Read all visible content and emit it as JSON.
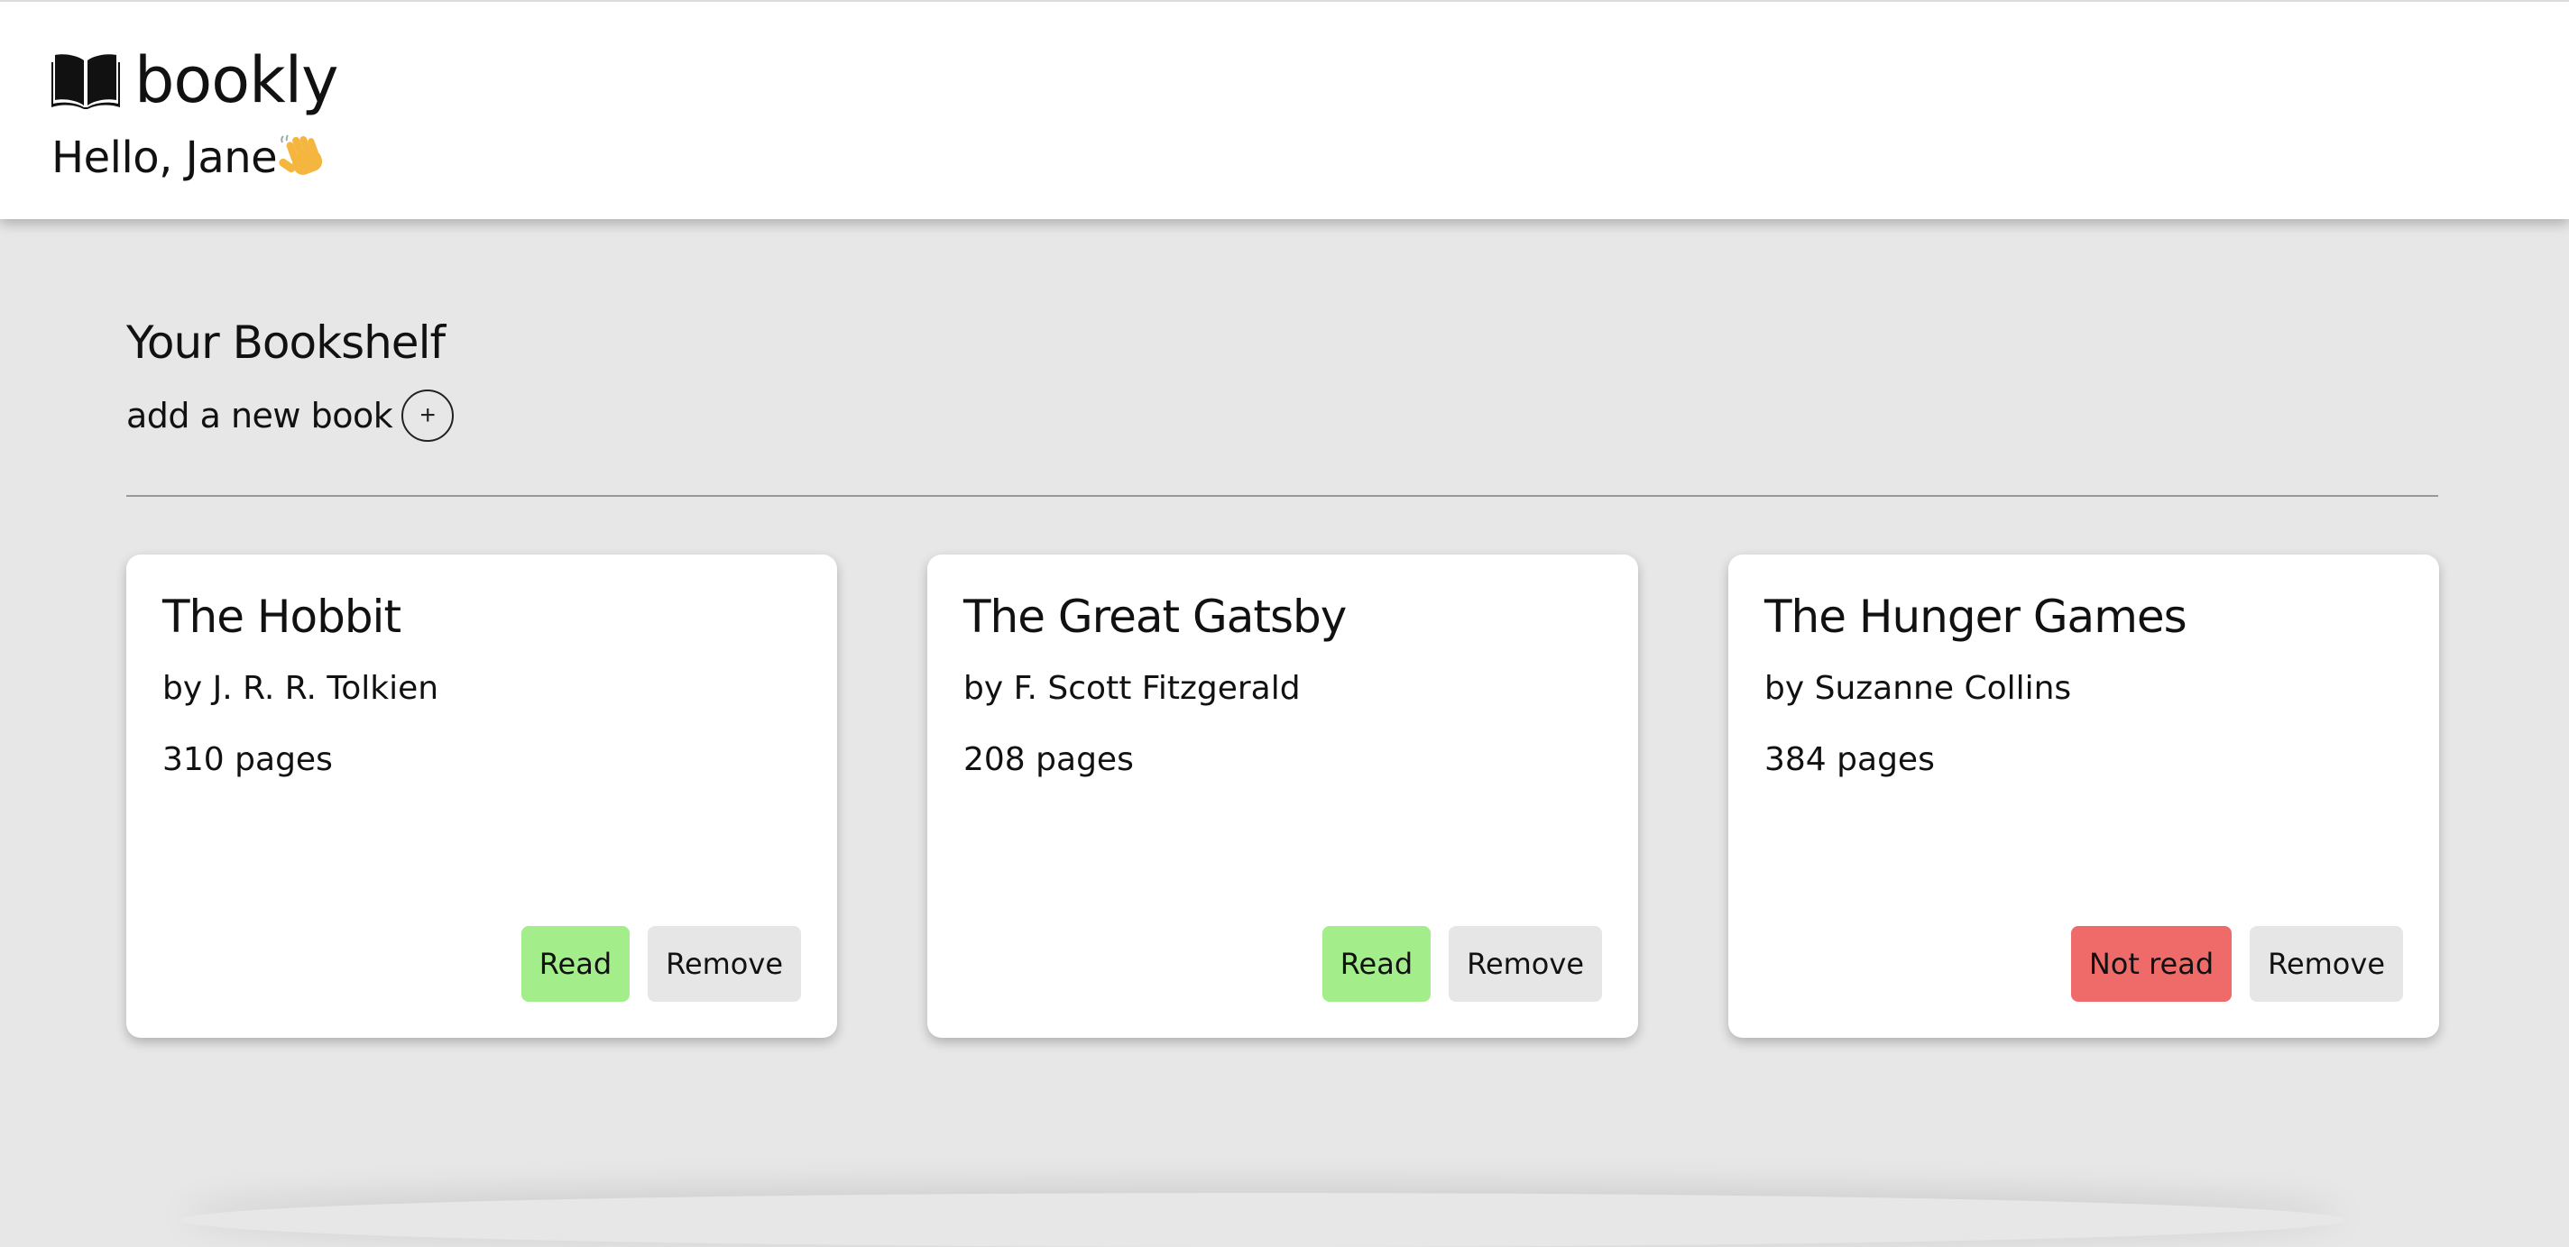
{
  "header": {
    "app_name": "bookly",
    "logo_icon": "open-book-icon",
    "greeting": "Hello, Jane",
    "greeting_icon": "waving-hand-icon"
  },
  "bookshelf": {
    "title": "Your Bookshelf",
    "add_label": "add a new book",
    "add_button_symbol": "+"
  },
  "books": [
    {
      "title": "The Hobbit",
      "author": "by J. R. R. Tolkien",
      "pages": "310 pages",
      "status_label": "Read",
      "status_color": "#a3ee8b",
      "remove_label": "Remove"
    },
    {
      "title": "The Great Gatsby",
      "author": "by F. Scott Fitzgerald",
      "pages": "208 pages",
      "status_label": "Read",
      "status_color": "#a3ee8b",
      "remove_label": "Remove"
    },
    {
      "title": "The Hunger Games",
      "author": "by Suzanne Collins",
      "pages": "384 pages",
      "status_label": "Not read",
      "status_color": "#ef6b69",
      "remove_label": "Remove"
    }
  ],
  "colors": {
    "background": "#e7e7e7",
    "card": "#ffffff",
    "read": "#a3ee8b",
    "not_read": "#ef6b69",
    "remove": "#e6e6e6"
  }
}
